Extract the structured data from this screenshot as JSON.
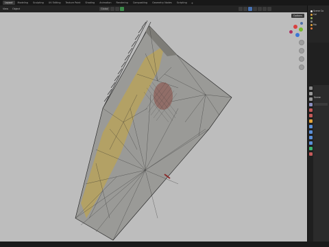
{
  "workspace_tabs": [
    "Layout",
    "Modeling",
    "Sculpting",
    "UV Editing",
    "Texture Paint",
    "Shading",
    "Animation",
    "Rendering",
    "Compositing",
    "Geometry Nodes",
    "Scripting"
  ],
  "active_tab": "Layout",
  "add_tab_symbol": "+",
  "viewport_header": {
    "view_menu": "View",
    "object_menu": "Object",
    "orientation": "Global"
  },
  "options_label": "Options",
  "outliner": {
    "rows": [
      "Scene Co",
      "Col",
      "",
      "",
      "Mo",
      ""
    ]
  },
  "properties": {
    "rows": [
      "Scene",
      "",
      "",
      "",
      "",
      "",
      "",
      "",
      "",
      "",
      "",
      ""
    ]
  },
  "colors": {
    "viewport_bg": "#bdbdbd",
    "mesh_gray": "#9a9a97",
    "mesh_yellow": "#c9a83c",
    "accent_blue": "#4772b3"
  }
}
